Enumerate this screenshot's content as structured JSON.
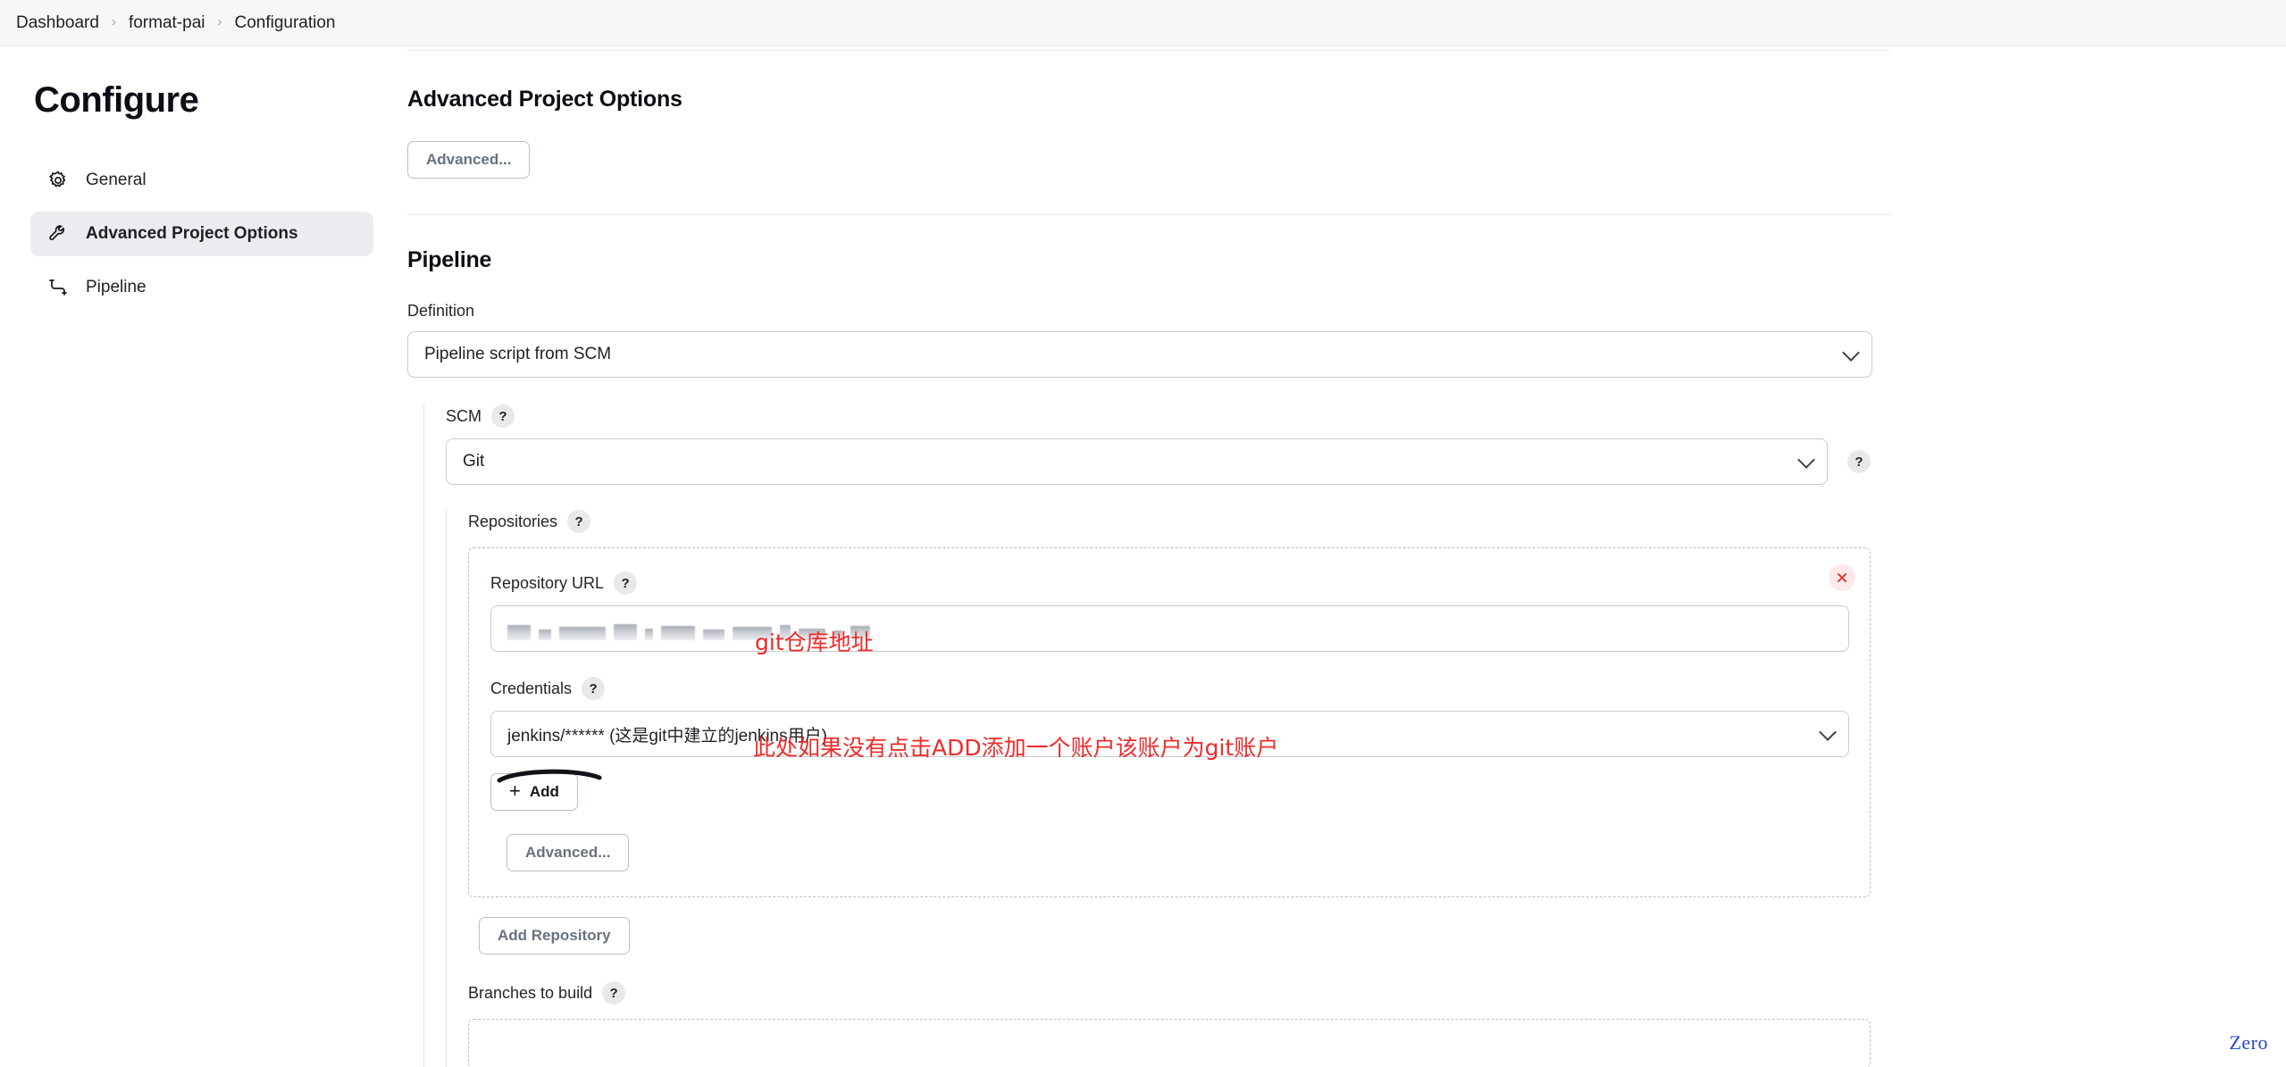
{
  "breadcrumb": {
    "separator": "›",
    "items": [
      {
        "label": "Dashboard"
      },
      {
        "label": "format-pai"
      },
      {
        "label": "Configuration"
      }
    ]
  },
  "sidebar": {
    "title": "Configure",
    "items": [
      {
        "label": "General",
        "icon": "gear-icon",
        "active": false
      },
      {
        "label": "Advanced Project Options",
        "icon": "wrench-icon",
        "active": true
      },
      {
        "label": "Pipeline",
        "icon": "pipeline-icon",
        "active": false
      }
    ]
  },
  "main": {
    "advanced_project_options": {
      "heading": "Advanced Project Options",
      "advanced_button": "Advanced..."
    },
    "pipeline": {
      "heading": "Pipeline",
      "definition": {
        "label": "Definition",
        "value": "Pipeline script from SCM"
      },
      "scm": {
        "label": "SCM",
        "help": "?",
        "value": "Git",
        "trailing_help": "?"
      },
      "repositories": {
        "label": "Repositories",
        "help": "?",
        "repository_url": {
          "label": "Repository URL",
          "help": "?",
          "value": "",
          "value_redacted": true
        },
        "credentials": {
          "label": "Credentials",
          "help": "?",
          "value": "jenkins/****** (这是git中建立的jenkins用户)"
        },
        "add_button": "Add",
        "advanced_button": "Advanced...",
        "add_repository_button": "Add Repository",
        "delete_icon": "close-icon"
      },
      "branches_to_build": {
        "label": "Branches to build",
        "help": "?"
      }
    }
  },
  "annotations": [
    {
      "text": "git仓库地址",
      "color": "#ef2b2b"
    },
    {
      "text": "此处如果没有点击ADD添加一个账户该账户为git账户",
      "color": "#ef2b2b"
    }
  ],
  "watermark": {
    "text": "Zero",
    "color": "#2a45c7"
  }
}
